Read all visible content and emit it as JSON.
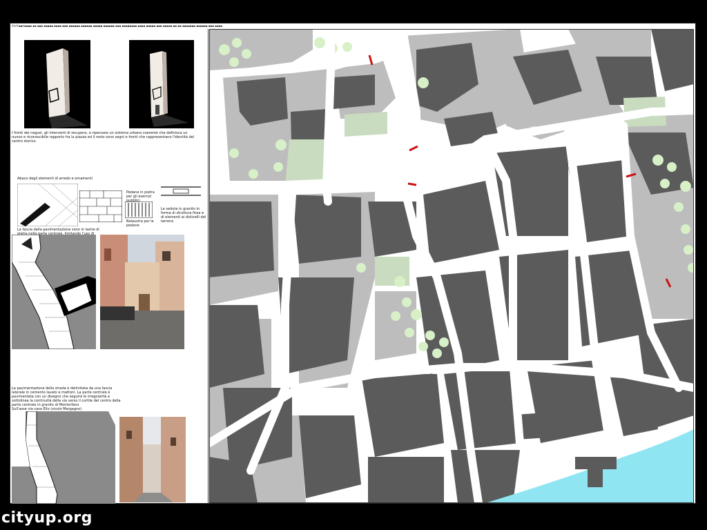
{
  "sheet": {
    "header_line": "Archi▪▪e▪▪▪▪ ▪▪ ▪▪▪  ▪▪▪▪▪ ▪▪▪▪ ▪▪▪ ▪▪▪▪▪▪ ▪▪▪▪▪▪ ▪▪▪▪▪ ▪▪▪▪▪▪ ▪▪▪ ▪▪▪▪▪▪▪▪ ▪▪▪▪ ▪▪▪▪▪ ▪▪▪ ▪▪▪▪▪ ▪▪ ▪▪ ▪▪▪▪▪▪▪ ▪▪▪▪▪▪ ▪▪▪ ▪▪▪▪"
  },
  "left_panel": {
    "intro_text": "I fronti dei negozi, gli interventi di recupero, e ripensare un sistema urbano coerente che definisca un nuovo e riconoscibile rapporto fra la piazza ed il resto sono segni e fronti che rappresentano l'identità del centro storico.",
    "legend_title": "Abaco degli elementi di arredo e ornamenti",
    "legend_note_1": "Pedane in pietra per gli esercizi pubblici",
    "legend_note_2": "Balaustra per le pedane",
    "legend_note_3": "Le sedute in granito in forma di struttura fissa e di elementi ai dislivelli del terreno",
    "section_caption_1": "La fascia della pavimentazione sono in lastre di pietra nella parte centrale, limitando l'uso di cemento e asfalti",
    "section_caption_2": "La pavimentazione della strada è delimitata da una fascia laterale in cemento lavato e mattoni. La parte centrale è pavimentata con un disegno che seguirà le irregolarità e sottolinea la continuità della via verso il cortile del centro della parte centrale in granito di Montorfano",
    "section_caption_3": "Sull'asse via casa Ello (vicolo Margagno)"
  },
  "watermark": {
    "text": "cityup.org"
  },
  "colors": {
    "building": "#5a5a5a",
    "street": "#ffffff",
    "courtyard": "#b9b9b9",
    "tree": "#d8f0c8",
    "water": "#8fe6f2",
    "accent": "#cc1111"
  }
}
